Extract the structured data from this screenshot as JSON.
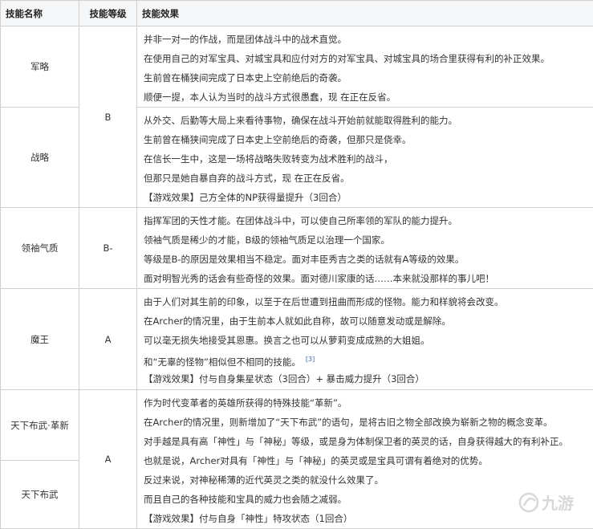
{
  "header": {
    "col1": "技能名称",
    "col2": "技能等级",
    "col3": "技能效果"
  },
  "rows": [
    {
      "name": "军略",
      "rank": "B",
      "lines": [
        "并非一对一的作战，而是团体战斗中的战术直觉。",
        "在使用自己的对军宝具、对城宝具和应付对方的对军宝具、对城宝具的场合里获得有利的补正效果。",
        "生前曾在桶狭间完成了日本史上空前绝后的奇袭。",
        "顺便一提，本人认为当时的战斗方式很愚蠢，现 在正在反省。"
      ]
    },
    {
      "name": "战略",
      "lines": [
        "从外交、后勤等大局上来看待事物，确保在战斗开始前就能取得胜利的能力。",
        "生前曾在桶狭间完成了日本史上空前绝后的奇袭，但那只是侥幸。",
        "在信长一生中，这是一场将战略失败转变为战术胜利的战斗，",
        "但那只是她自暴自弃的战斗方式，现 在正在反省。",
        "【游戏效果】己方全体的NP获得量提升（3回合）"
      ]
    },
    {
      "name": "领袖气质",
      "rank": "B-",
      "lines": [
        "指挥军团的天性才能。在团体战斗中，可以使自己所率领的军队的能力提升。",
        "领袖气质是稀少的才能，B级的领袖气质足以治理一个国家。",
        "等级是B-的原因是效果相当不稳定。面对丰臣秀吉之类的话就有A等级的效果。",
        "面对明智光秀的话会有些奇怪的效果。面对德川家康的话……本来就没那样的事儿吧！"
      ]
    },
    {
      "name": "魔王",
      "rank": "A",
      "lines": [
        "由于人们对其生前的印象，以至于在后世遭到扭曲而形成的怪物。能力和样貌将会改变。",
        "在Archer的情况里，由于生前本人就如此自称，故可以随意发动或是解除。",
        "可以毫无损失地接受其恩惠。换言之也可以从萝莉变成成熟的大姐姐。",
        "和“无辜的怪物”相似但不相同的技能。",
        "【游戏效果】付与自身集星状态（3回合）+ 暴击威力提升（3回合）"
      ],
      "ref": "[3]"
    },
    {
      "name": "天下布武·革新",
      "rank": "A",
      "lines": [
        "作为时代变革者的英雄所获得的特殊技能“革新”。",
        "在Archer的情况里，则新增加了“天下布武”的语句，是将古旧之物全部改换为崭新之物的概念变革。",
        "对手越是具有高「神性」与「神秘」等级，或是身为体制保卫者的英灵的话，自身获得越大的有利补正。",
        "也就是说，Archer对具有「神性」与「神秘」的英灵或是宝具可谓有着绝对的优势。",
        "反过来说，对神秘稀薄的近代英灵之类的就没什么效果了。",
        "而且自己的各种技能和宝具的威力也会随之减弱。",
        "【游戏效果】付与自身「神性」特攻状态（1回合）"
      ]
    },
    {
      "name": "天下布武"
    }
  ],
  "watermark": {
    "text": "九游"
  },
  "colors": {
    "border": "#d0d0d0",
    "header_bg": "#f5f6f7",
    "text": "#333333",
    "ref": "#3366cc"
  }
}
